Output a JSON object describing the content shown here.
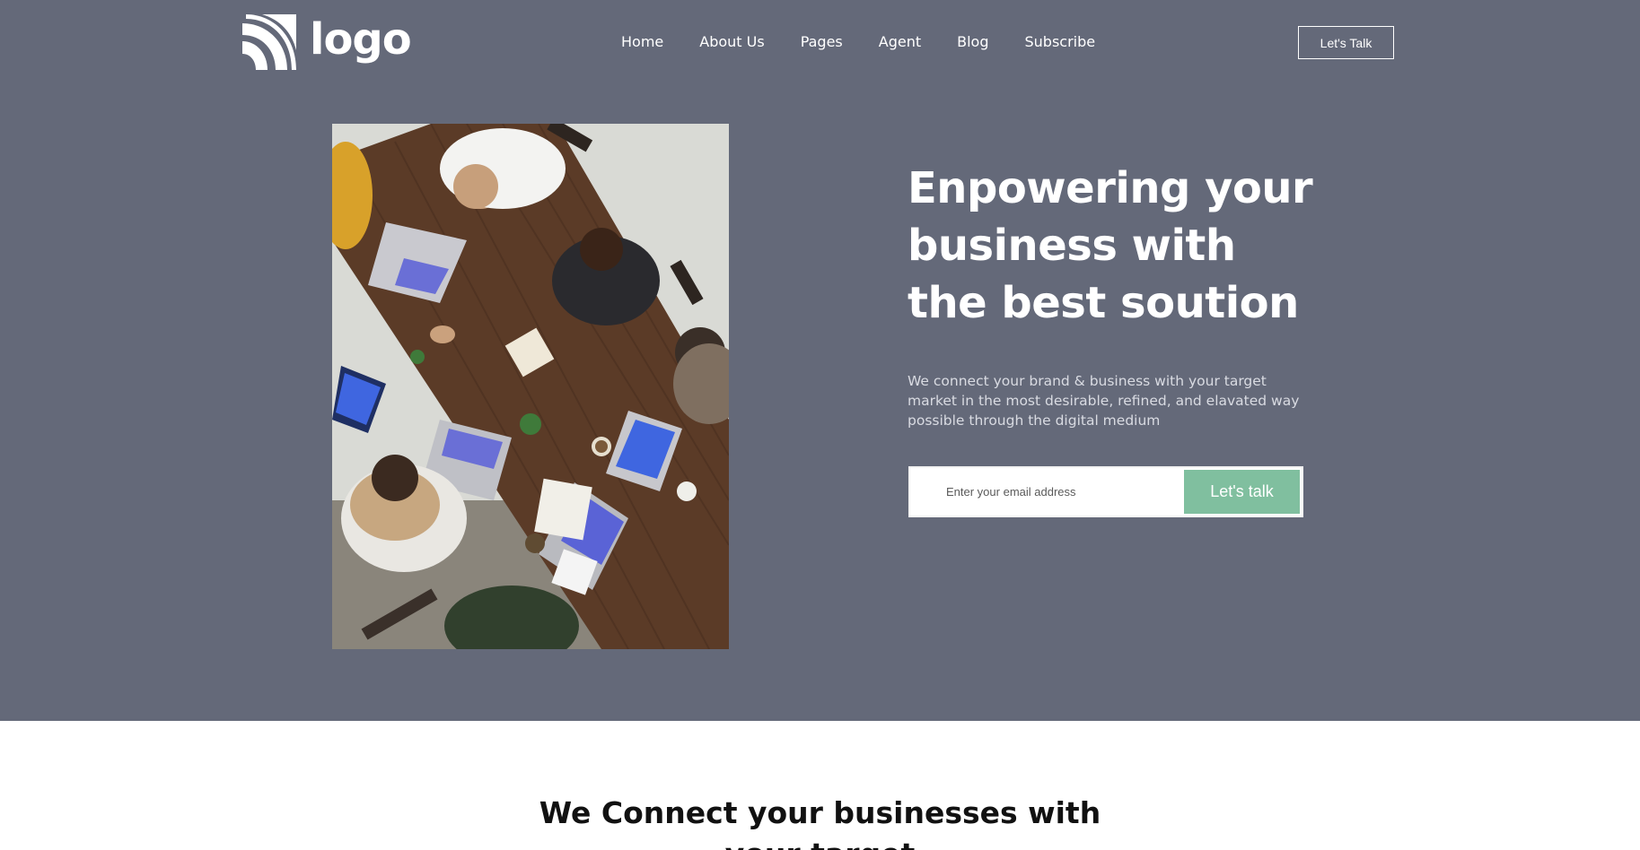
{
  "header": {
    "logo_text": "logo",
    "nav": [
      "Home",
      "About Us",
      "Pages",
      "Agent",
      "Blog",
      "Subscribe"
    ],
    "cta_label": "Let's Talk"
  },
  "hero": {
    "background": "#646979",
    "title": "Enpowering your business with the best soution",
    "subtitle": "We connect your brand & business with your target market in the most desirable, refined, and elavated way possible through the digital medium",
    "email_placeholder": "Enter your email address",
    "email_value": "",
    "submit_label": "Let's talk",
    "submit_color": "#80bf9f",
    "image_description_icon": "team-meeting-photo"
  },
  "section2": {
    "title_line1": "We Connect your businesses with",
    "title_line2": "your target"
  }
}
